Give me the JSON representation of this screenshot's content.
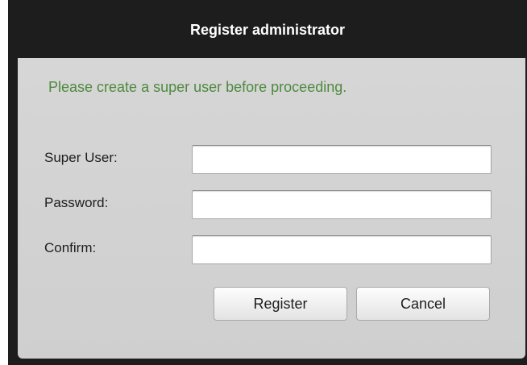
{
  "window": {
    "title": "Register administrator"
  },
  "notice": "Please create a super user before proceeding.",
  "form": {
    "fields": [
      {
        "label": "Super User:",
        "value": "",
        "placeholder": ""
      },
      {
        "label": "Password:",
        "value": "",
        "placeholder": ""
      },
      {
        "label": "Confirm:",
        "value": "",
        "placeholder": ""
      }
    ]
  },
  "buttons": {
    "register_label": "Register",
    "cancel_label": "Cancel"
  },
  "colors": {
    "title_bar": "#1d1d1d",
    "panel": "#d3d3d3",
    "notice_text": "#4e8a3e"
  }
}
